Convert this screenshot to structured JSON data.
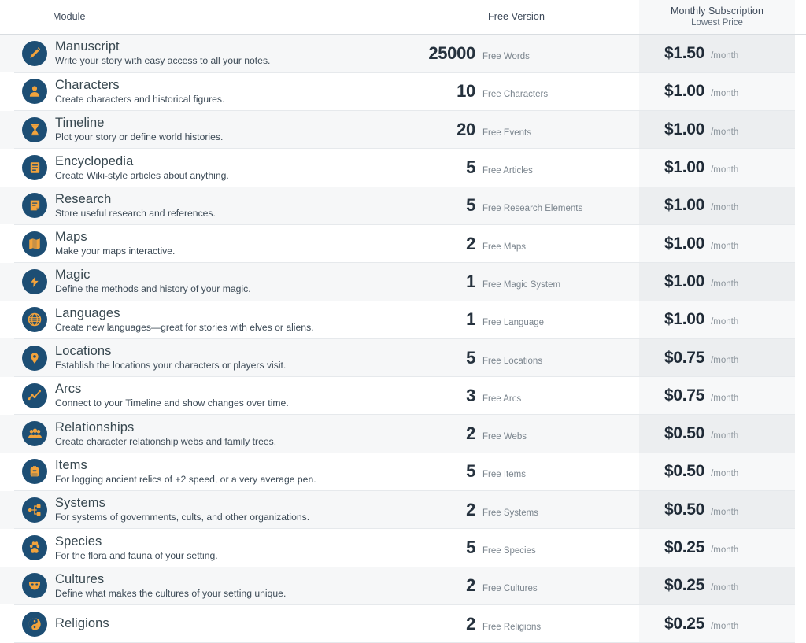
{
  "theme": {
    "icon_circle": "#1d4e74",
    "icon_glyph": "#f2a33c",
    "row_alt_bg": "#f6f7f8",
    "sub_column_bg": "#f7f8f9",
    "sub_column_alt_bg": "#eceef0",
    "title_color": "#37474f",
    "value_color": "#26323e"
  },
  "header": {
    "module": "Module",
    "free_version": "Free Version",
    "monthly_subscription": "Monthly Subscription",
    "monthly_subscription_sub": "Lowest Price"
  },
  "rows": [
    {
      "icon": "pencil-icon",
      "title": "Manuscript",
      "description": "Write your story with easy access to all your notes.",
      "free_amount": "25000",
      "free_unit": "Free Words",
      "price": "$1.50",
      "price_period": "/month"
    },
    {
      "icon": "user-icon",
      "title": "Characters",
      "description": "Create characters and historical figures.",
      "free_amount": "10",
      "free_unit": "Free Characters",
      "price": "$1.00",
      "price_period": "/month"
    },
    {
      "icon": "hourglass-icon",
      "title": "Timeline",
      "description": "Plot your story or define world histories.",
      "free_amount": "20",
      "free_unit": "Free Events",
      "price": "$1.00",
      "price_period": "/month"
    },
    {
      "icon": "book-page-icon",
      "title": "Encyclopedia",
      "description": "Create Wiki-style articles about anything.",
      "free_amount": "5",
      "free_unit": "Free Articles",
      "price": "$1.00",
      "price_period": "/month"
    },
    {
      "icon": "sticky-note-icon",
      "title": "Research",
      "description": "Store useful research and references.",
      "free_amount": "5",
      "free_unit": "Free Research Elements",
      "price": "$1.00",
      "price_period": "/month"
    },
    {
      "icon": "map-icon",
      "title": "Maps",
      "description": "Make your maps interactive.",
      "free_amount": "2",
      "free_unit": "Free Maps",
      "price": "$1.00",
      "price_period": "/month"
    },
    {
      "icon": "lightning-bolt-icon",
      "title": "Magic",
      "description": "Define the methods and history of your magic.",
      "free_amount": "1",
      "free_unit": "Free Magic System",
      "price": "$1.00",
      "price_period": "/month"
    },
    {
      "icon": "globe-icon",
      "title": "Languages",
      "description": "Create new languages—great for stories with elves or aliens.",
      "free_amount": "1",
      "free_unit": "Free Language",
      "price": "$1.00",
      "price_period": "/month"
    },
    {
      "icon": "map-pin-icon",
      "title": "Locations",
      "description": "Establish the locations your characters or players visit.",
      "free_amount": "5",
      "free_unit": "Free Locations",
      "price": "$0.75",
      "price_period": "/month"
    },
    {
      "icon": "line-chart-icon",
      "title": "Arcs",
      "description": "Connect to your Timeline and show changes over time.",
      "free_amount": "3",
      "free_unit": "Free Arcs",
      "price": "$0.75",
      "price_period": "/month"
    },
    {
      "icon": "users-group-icon",
      "title": "Relationships",
      "description": "Create character relationship webs and family trees.",
      "free_amount": "2",
      "free_unit": "Free Webs",
      "price": "$0.50",
      "price_period": "/month"
    },
    {
      "icon": "backpack-icon",
      "title": "Items",
      "description": "For logging ancient relics of +2 speed, or a very average pen.",
      "free_amount": "5",
      "free_unit": "Free Items",
      "price": "$0.50",
      "price_period": "/month"
    },
    {
      "icon": "sitemap-icon",
      "title": "Systems",
      "description": "For systems of governments, cults, and other organizations.",
      "free_amount": "2",
      "free_unit": "Free Systems",
      "price": "$0.50",
      "price_period": "/month"
    },
    {
      "icon": "paw-print-icon",
      "title": "Species",
      "description": "For the flora and fauna of your setting.",
      "free_amount": "5",
      "free_unit": "Free Species",
      "price": "$0.25",
      "price_period": "/month"
    },
    {
      "icon": "mask-icon",
      "title": "Cultures",
      "description": "Define what makes the cultures of your setting unique.",
      "free_amount": "2",
      "free_unit": "Free Cultures",
      "price": "$0.25",
      "price_period": "/month"
    },
    {
      "icon": "yin-yang-icon",
      "title": "Religions",
      "description": "",
      "free_amount": "2",
      "free_unit": "Free Religions",
      "price": "$0.25",
      "price_period": "/month"
    }
  ]
}
